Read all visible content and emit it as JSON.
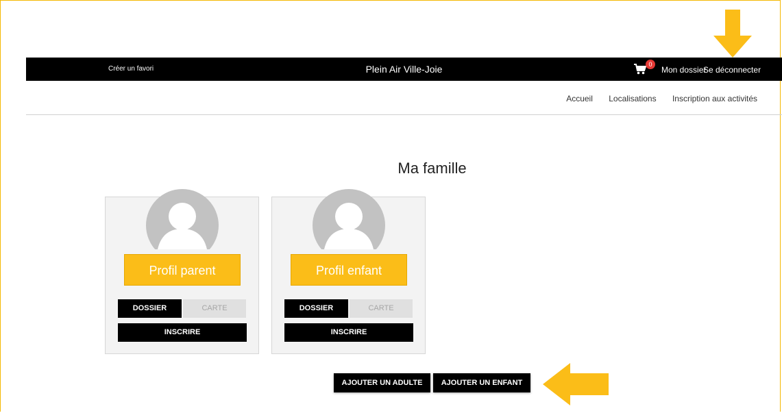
{
  "header": {
    "favorite_link": "Créer un favori",
    "brand": "Plein Air Ville-Joie",
    "cart_count": "0",
    "my_file": "Mon dossier",
    "logout": "Se déconnecter"
  },
  "nav": {
    "items": [
      "Accueil",
      "Localisations",
      "Inscription aux activités"
    ]
  },
  "page": {
    "title": "Ma famille"
  },
  "cards": [
    {
      "profile_label": "Profil parent",
      "dossier_label": "DOSSIER",
      "carte_label": "CARTE",
      "inscrire_label": "INSCRIRE"
    },
    {
      "profile_label": "Profil enfant",
      "dossier_label": "DOSSIER",
      "carte_label": "CARTE",
      "inscrire_label": "INSCRIRE"
    }
  ],
  "actions": {
    "add_adult": "AJOUTER UN ADULTE",
    "add_child": "AJOUTER UN ENFANT"
  },
  "colors": {
    "accent": "#fbbd18",
    "badge": "#e53935",
    "topbar": "#000000"
  },
  "icons": [
    "cart-icon",
    "avatar-icon",
    "arrow-down-icon",
    "arrow-left-icon"
  ]
}
